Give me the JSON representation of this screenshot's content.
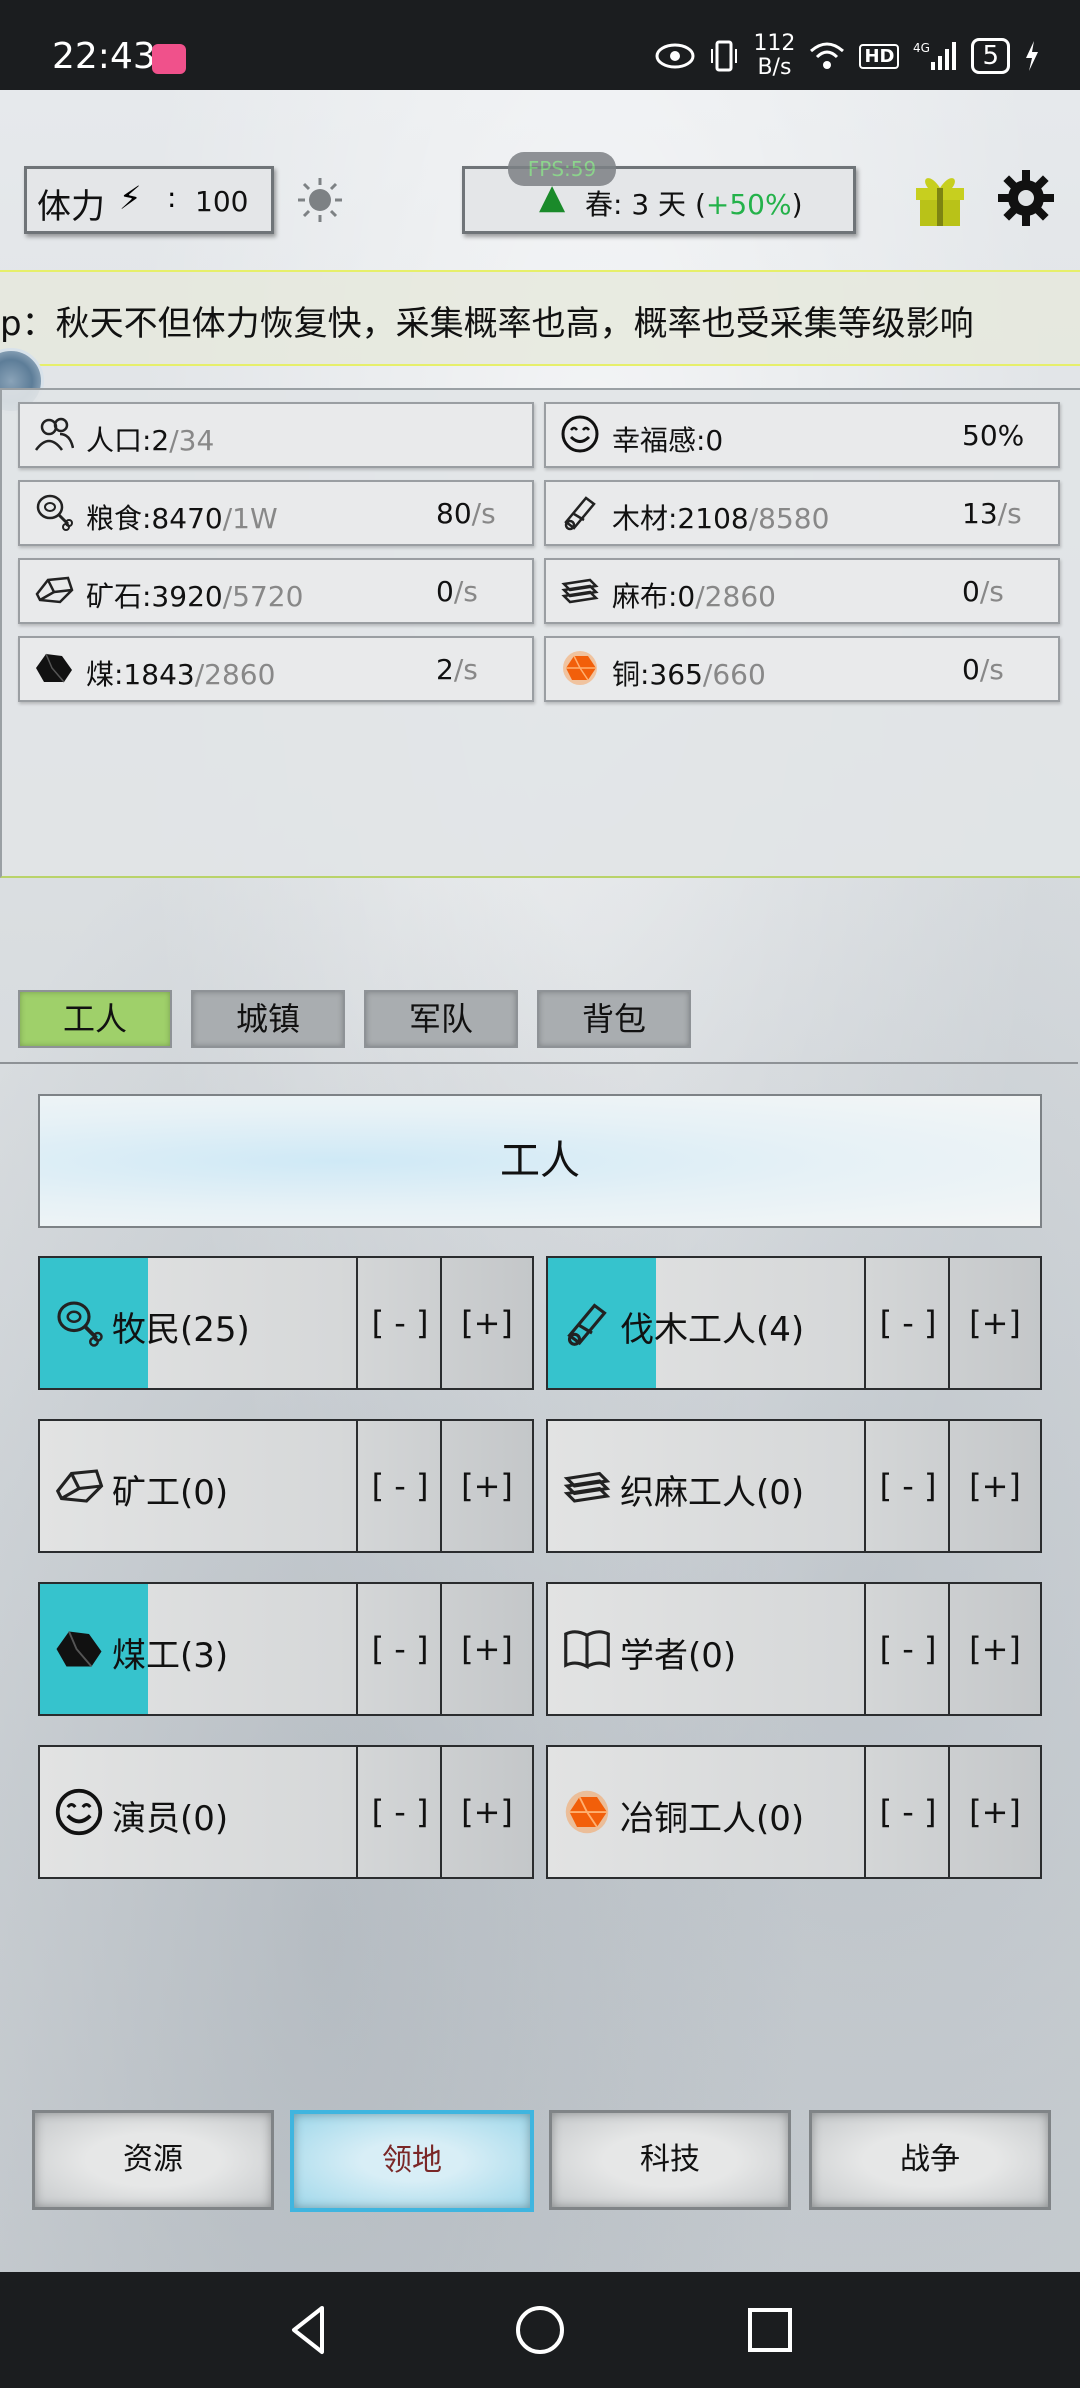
{
  "status_bar": {
    "time": "22:43",
    "net_speed_value": "112",
    "net_speed_unit": "B/s",
    "hd_label": "HD",
    "network": "4G",
    "battery": "5"
  },
  "top_bar": {
    "stamina_label": "体力",
    "stamina_value": "100",
    "fps_label": "FPS:59",
    "season_prefix": "春: 3 天 (",
    "season_bonus": "+50%",
    "season_suffix": ")"
  },
  "tip": {
    "text": "p：秋天不但体力恢复快，采集概率也高，概率也受采集等级影响"
  },
  "resources": [
    {
      "name": "人口:2",
      "cap": "/34",
      "rate": "",
      "rate_unit": "",
      "icon": "people-icon"
    },
    {
      "name": "幸福感:0",
      "cap": "",
      "rate": "50%",
      "rate_unit": "",
      "icon": "smile-icon"
    },
    {
      "name": "粮食:8470",
      "cap": "/1W",
      "rate": "80",
      "rate_unit": "/s",
      "icon": "meat-icon"
    },
    {
      "name": "木材:2108",
      "cap": "/8580",
      "rate": "13",
      "rate_unit": "/s",
      "icon": "wood-icon"
    },
    {
      "name": "矿石:3920",
      "cap": "/5720",
      "rate": "0",
      "rate_unit": "/s",
      "icon": "ore-icon"
    },
    {
      "name": "麻布:0",
      "cap": "/2860",
      "rate": "0",
      "rate_unit": "/s",
      "icon": "linen-icon"
    },
    {
      "name": "煤:1843",
      "cap": "/2860",
      "rate": "2",
      "rate_unit": "/s",
      "icon": "coal-icon"
    },
    {
      "name": "铜:365",
      "cap": "/660",
      "rate": "0",
      "rate_unit": "/s",
      "icon": "copper-icon"
    }
  ],
  "tabs": [
    "工人",
    "城镇",
    "军队",
    "背包"
  ],
  "workers": {
    "header": "工人",
    "minus_label": "[ - ]",
    "plus_label": "[+]",
    "items": [
      {
        "label": "牧民(25)",
        "icon": "meat-icon",
        "fill": 0.22
      },
      {
        "label": "伐木工人(4)",
        "icon": "wood-icon",
        "fill": 0.22
      },
      {
        "label": "矿工(0)",
        "icon": "ore-icon",
        "fill": 0
      },
      {
        "label": "织麻工人(0)",
        "icon": "linen-icon",
        "fill": 0
      },
      {
        "label": "煤工(3)",
        "icon": "coal-icon",
        "fill": 0.22
      },
      {
        "label": "学者(0)",
        "icon": "book-icon",
        "fill": 0
      },
      {
        "label": "演员(0)",
        "icon": "smile-icon",
        "fill": 0
      },
      {
        "label": "冶铜工人(0)",
        "icon": "copper-icon",
        "fill": 0
      }
    ]
  },
  "bottom_nav": [
    "资源",
    "领地",
    "科技",
    "战争"
  ],
  "colors": {
    "active_tab": "#9fd06a",
    "worker_fill": "#36c3cd",
    "season_bonus": "#24b24a",
    "active_nav_border": "#3fb5df"
  }
}
